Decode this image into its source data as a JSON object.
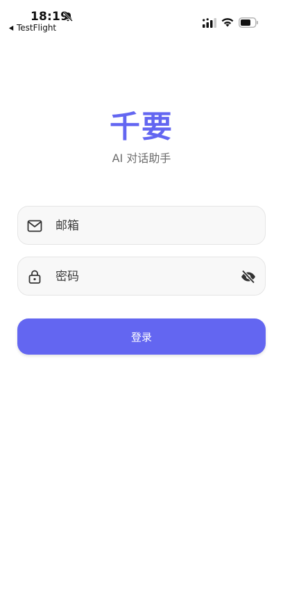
{
  "status_bar": {
    "time": "18:19",
    "back_label": "TestFlight",
    "icons": [
      "bell-slash-icon",
      "cellular-signal-icon",
      "wifi-icon",
      "battery-icon"
    ]
  },
  "brand": {
    "title": "千要",
    "subtitle": "AI 对话助手",
    "accent_color": "#6366f1"
  },
  "form": {
    "email_placeholder": "邮箱",
    "password_placeholder": "密码",
    "email_icon": "mail-icon",
    "password_icon": "lock-icon",
    "visibility_icon": "eye-off-icon",
    "submit_label": "登录"
  }
}
